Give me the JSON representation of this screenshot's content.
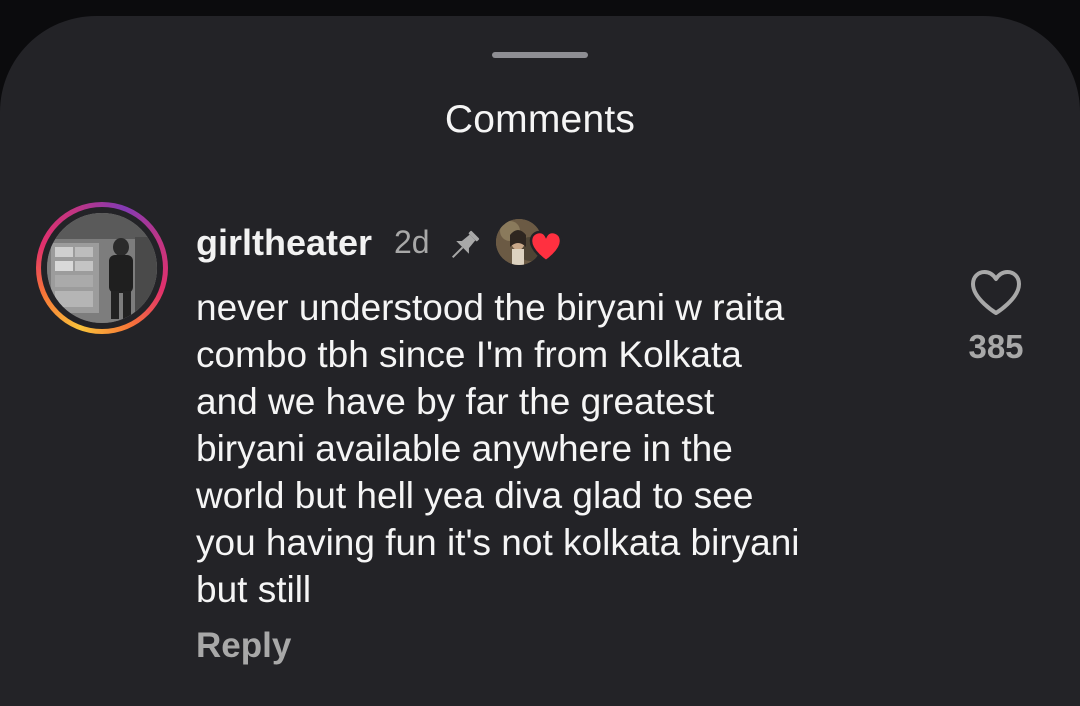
{
  "sheet": {
    "title": "Comments"
  },
  "comment": {
    "username": "girltheater",
    "time": "2d",
    "pinned": true,
    "liked_by_creator": true,
    "text_lines": [
      "never understood the biryani w raita",
      "combo tbh since I'm from Kolkata",
      "and we have by far the greatest",
      "biryani available anywhere in the",
      "world but hell yea diva glad to see",
      "you having fun it's not kolkata biryani",
      "but still"
    ],
    "reply_label": "Reply",
    "like_count": "385",
    "icons": {
      "pin": "pin-icon",
      "like": "heart-outline-icon",
      "creator_like": "heart-filled-icon"
    }
  },
  "colors": {
    "background": "#232327",
    "text": "#f5f5f5",
    "muted": "#a8a8a8",
    "heart_red": "#ff3040"
  }
}
